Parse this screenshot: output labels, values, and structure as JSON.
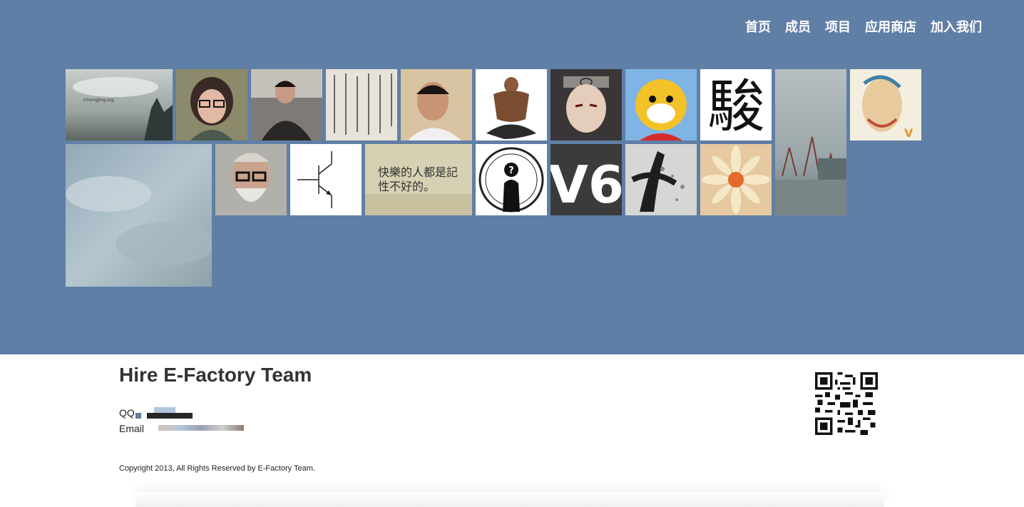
{
  "nav": {
    "items": [
      "首页",
      "成员",
      "项目",
      "应用商店",
      "加入我们"
    ]
  },
  "tiles": {
    "sky": {
      "watermark": "ichongjing.org"
    },
    "calligraphy_card": {
      "text": "快樂的人都是記性不好的。"
    },
    "chinese_char": {
      "text": "駿"
    },
    "v6": {
      "text": "V6"
    },
    "anonymous": {
      "mark": "?"
    }
  },
  "footer": {
    "title": "Hire E-Factory Team",
    "qq_label": "QQ",
    "email_label": "Email",
    "copyright": "Copyright 2013, All Rights Reserved by E-Factory Team."
  },
  "colors": {
    "hero_bg": "#607fa6",
    "title_text": "#333333"
  }
}
